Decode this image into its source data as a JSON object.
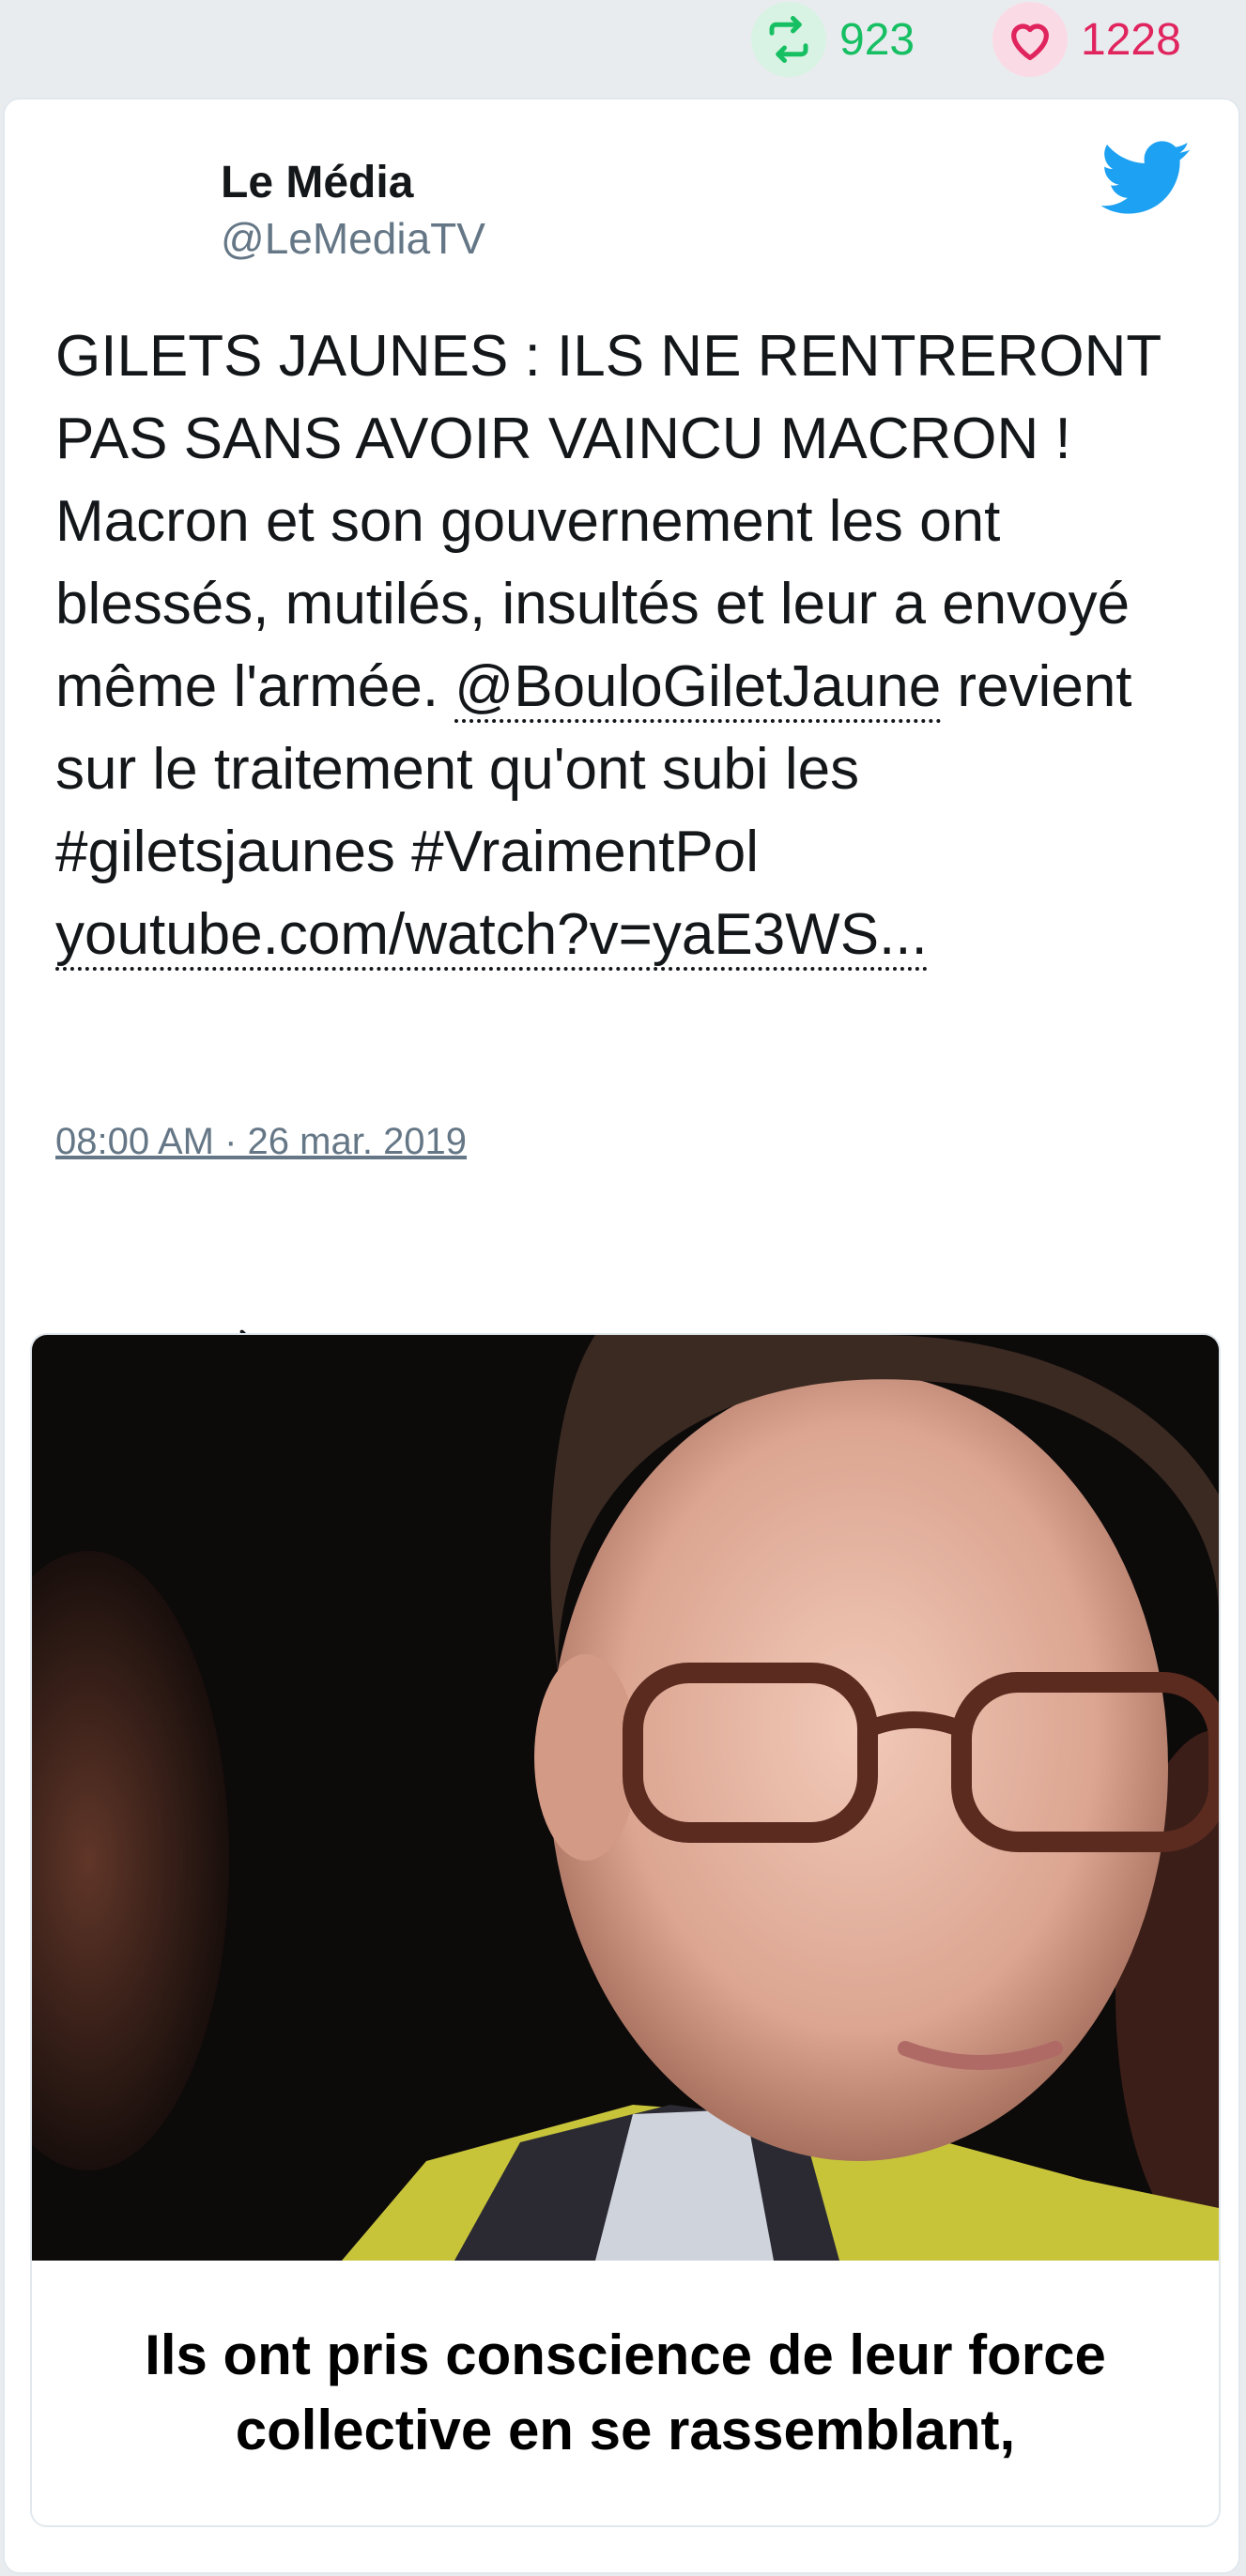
{
  "stats": {
    "retweets": "923",
    "likes": "1228",
    "retweet_color": "#17bf63",
    "like_color": "#e0245e",
    "retweet_icon": "retweet-icon",
    "like_icon": "heart-icon"
  },
  "tweet": {
    "author_name": "Le Média",
    "author_handle": "@LeMediaTV",
    "platform_icon": "twitter-bird-icon",
    "text_part1": "GILETS JAUNES : ILS NE RENTRERONT PAS SANS AVOIR VAINCU MACRON ! Macron et son gouvernement les ont blessés, mutilés, insultés et leur a envoyé même l'armée. ",
    "mention": "@BouloGiletJaune",
    "text_part2": " revient sur le traitement qu'ont subi les #giletsjaunes #VraimentPol ",
    "link": "youtube.com/watch?v=yaE3WS...",
    "timestamp": "08:00 AM · 26 mar. 2019",
    "accent_color": "#1da1f2"
  },
  "actions": {
    "reply_icon": "reply-icon",
    "retweet_icon": "retweet-icon",
    "like_icon": "heart-icon"
  },
  "media": {
    "caption_line1": "Ils ont pris conscience de leur force",
    "caption_line2": "collective en se rassemblant,"
  }
}
